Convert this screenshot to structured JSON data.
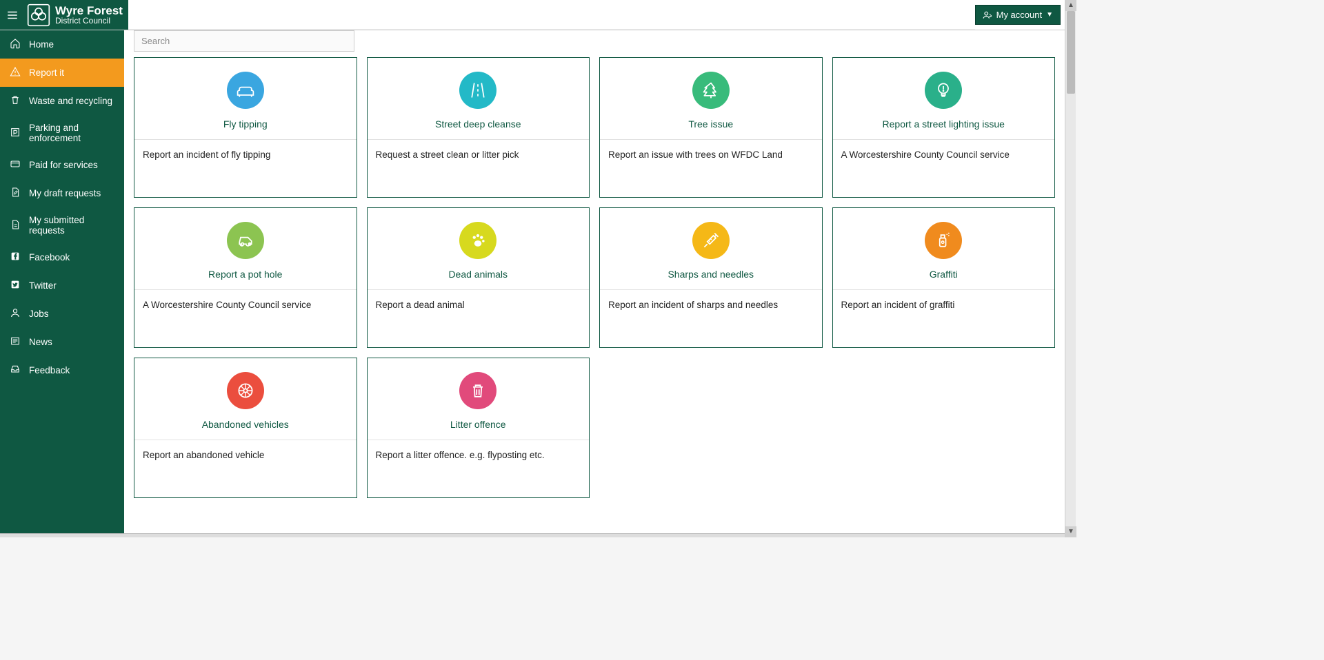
{
  "header": {
    "brand_top": "Wyre Forest",
    "brand_bottom": "District Council",
    "account_label": "My account"
  },
  "search": {
    "placeholder": "Search"
  },
  "sidebar": {
    "items": [
      {
        "id": "home",
        "label": "Home",
        "icon": "home",
        "active": false
      },
      {
        "id": "report-it",
        "label": "Report it",
        "icon": "alert",
        "active": true
      },
      {
        "id": "waste",
        "label": "Waste and recycling",
        "icon": "trash",
        "active": false
      },
      {
        "id": "parking",
        "label": "Parking and enforcement",
        "icon": "parking",
        "active": false
      },
      {
        "id": "paid",
        "label": "Paid for services",
        "icon": "card",
        "active": false
      },
      {
        "id": "draft",
        "label": "My draft requests",
        "icon": "doc-pencil",
        "active": false
      },
      {
        "id": "submitted",
        "label": "My submitted requests",
        "icon": "doc",
        "active": false
      },
      {
        "id": "facebook",
        "label": "Facebook",
        "icon": "facebook",
        "active": false
      },
      {
        "id": "twitter",
        "label": "Twitter",
        "icon": "twitter",
        "active": false
      },
      {
        "id": "jobs",
        "label": "Jobs",
        "icon": "person",
        "active": false
      },
      {
        "id": "news",
        "label": "News",
        "icon": "news",
        "active": false
      },
      {
        "id": "feedback",
        "label": "Feedback",
        "icon": "inbox",
        "active": false
      }
    ]
  },
  "cards": [
    {
      "id": "fly-tipping",
      "title": "Fly tipping",
      "desc": "Report an incident of fly tipping",
      "color": "#3aa6e0",
      "icon": "sofa"
    },
    {
      "id": "street-clean",
      "title": "Street deep cleanse",
      "desc": "Request a street clean or litter pick",
      "color": "#23b9c7",
      "icon": "road"
    },
    {
      "id": "tree",
      "title": "Tree issue",
      "desc": "Report an issue with trees on WFDC Land",
      "color": "#38bb7b",
      "icon": "tree"
    },
    {
      "id": "lighting",
      "title": "Report a street lighting issue",
      "desc": "A Worcestershire County Council service",
      "color": "#2ab08a",
      "icon": "bulb"
    },
    {
      "id": "pothole",
      "title": "Report a pot hole",
      "desc": "A Worcestershire County Council service",
      "color": "#8cc451",
      "icon": "car"
    },
    {
      "id": "dead-animals",
      "title": "Dead animals",
      "desc": "Report a dead animal",
      "color": "#d7d91e",
      "icon": "paw"
    },
    {
      "id": "sharps",
      "title": "Sharps and needles",
      "desc": "Report an incident of sharps and needles",
      "color": "#f5b817",
      "icon": "syringe"
    },
    {
      "id": "graffiti",
      "title": "Graffiti",
      "desc": "Report an incident of graffiti",
      "color": "#f08b1e",
      "icon": "spray"
    },
    {
      "id": "abandoned",
      "title": "Abandoned vehicles",
      "desc": "Report an abandoned vehicle",
      "color": "#eb4e3e",
      "icon": "wheel"
    },
    {
      "id": "litter",
      "title": "Litter offence",
      "desc": "Report a litter offence. e.g. flyposting etc.",
      "color": "#e14a7b",
      "icon": "bin"
    }
  ]
}
